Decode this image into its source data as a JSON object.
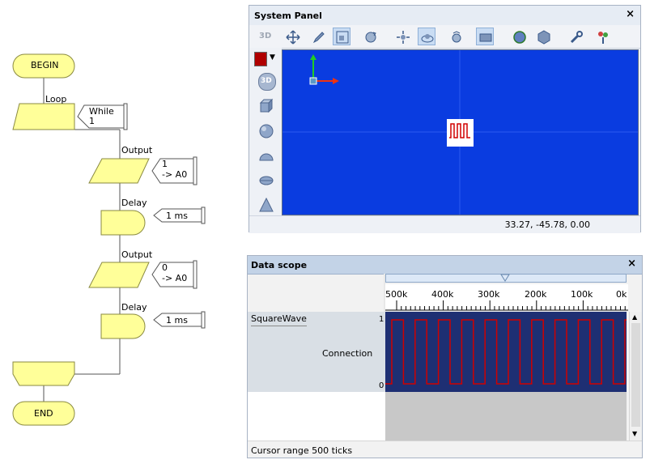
{
  "flowchart": {
    "begin_label": "BEGIN",
    "loop_label": "Loop",
    "while_label": "While",
    "while_value": "1",
    "output1_label": "Output",
    "output1_value": "1",
    "output1_target": "-> A0",
    "delay1_label": "Delay",
    "delay1_value": "1 ms",
    "output2_label": "Output",
    "output2_value": "0",
    "output2_target": "-> A0",
    "delay2_label": "Delay",
    "delay2_value": "1 ms",
    "end_label": "END",
    "colors": {
      "block_fill": "#ffff99",
      "block_stroke": "#8a8a40"
    }
  },
  "system_panel": {
    "title": "System Panel",
    "close_label": "×",
    "toolbar_3d_label": "3D",
    "side_3d_label": "3D",
    "coords": "33.27, -45.78, 0.00",
    "toolbar_icons": [
      "3d-icon",
      "move-icon",
      "pencil-icon",
      "zoom-fit-icon",
      "rotate-icon",
      "pan-icon",
      "orbit-icon",
      "camera-icon",
      "rectangle-view-icon",
      "sphere-icon",
      "box-icon",
      "wrench-icon",
      "paint-icon"
    ],
    "side_icons": [
      "color-swatch-icon",
      "3d-icon",
      "cube-icon",
      "sphere-icon",
      "hemisphere-icon",
      "disc-icon",
      "cone-icon"
    ],
    "colors": {
      "viewport": "#0a3ce0",
      "swatch": "#b00000",
      "wave": "#d00000"
    }
  },
  "data_scope": {
    "title": "Data scope",
    "close_label": "×",
    "ruler_labels": [
      "500k",
      "400k",
      "300k",
      "200k",
      "100k",
      "0k"
    ],
    "trace_name": "SquareWave",
    "trace_source": "Connection",
    "y_max_label": "1",
    "y_min_label": "0",
    "status": "Cursor range 500 ticks",
    "colors": {
      "plot_bg": "#1e2f73",
      "trace": "#d00000"
    }
  }
}
